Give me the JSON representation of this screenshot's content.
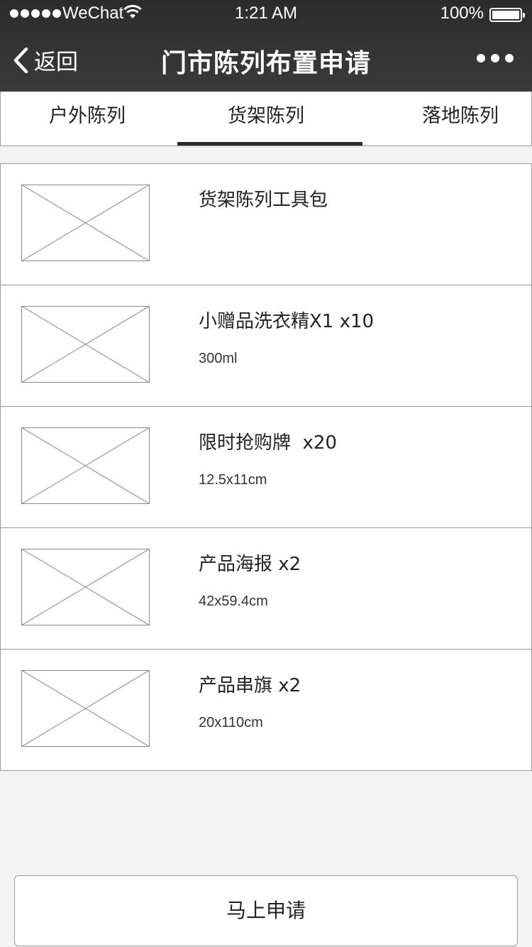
{
  "status_bar": {
    "carrier": "WeChat",
    "time": "1:21 AM",
    "battery": "100%"
  },
  "nav": {
    "back_label": "返回",
    "title": "门市陈列布置申请"
  },
  "tabs": [
    {
      "label": "户外陈列"
    },
    {
      "label": "货架陈列"
    },
    {
      "label": "落地陈列"
    }
  ],
  "active_tab": "货架陈列",
  "items": [
    {
      "title": "货架陈列工具包",
      "spec": ""
    },
    {
      "title": "小赠品洗衣精X1 x10",
      "spec": "300ml"
    },
    {
      "title": "限时抢购牌  x20",
      "spec": "12.5x11cm"
    },
    {
      "title": "产品海报 x2",
      "spec": "42x59.4cm"
    },
    {
      "title": "产品串旗 x2",
      "spec": "20x110cm"
    }
  ],
  "apply_button": "马上申请"
}
